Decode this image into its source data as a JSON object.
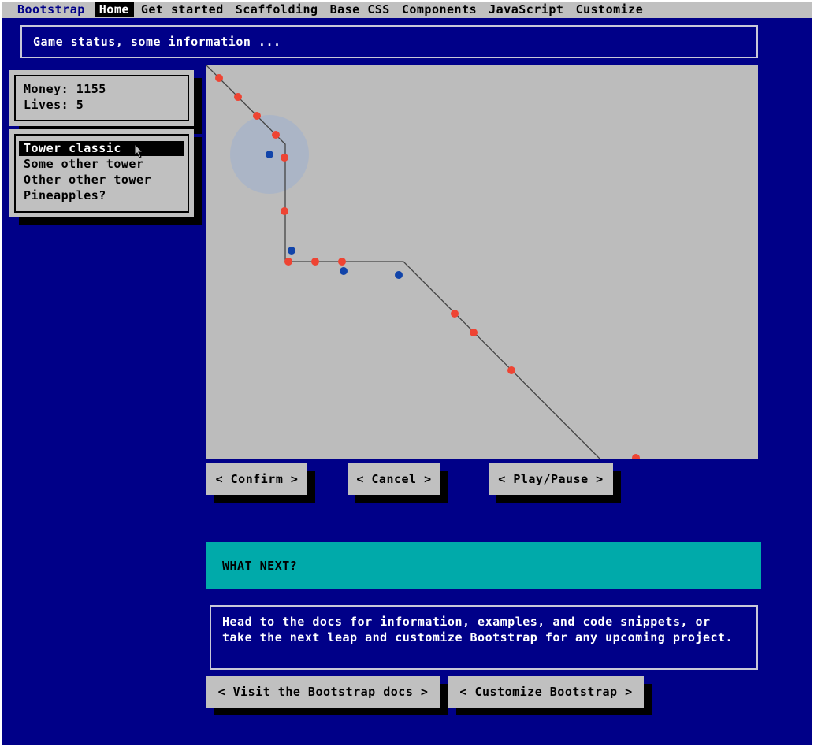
{
  "navbar": {
    "brand": "Bootstrap",
    "items": [
      "Home",
      "Get started",
      "Scaffolding",
      "Base CSS",
      "Components",
      "JavaScript",
      "Customize"
    ],
    "active": "Home"
  },
  "status_text": "Game status, some information ...",
  "stats": {
    "money": "Money: 1155",
    "lives": "Lives: 5"
  },
  "towers": {
    "items": [
      "Tower classic",
      "Some other tower",
      "Other other tower",
      "Pineapples?"
    ],
    "selected": "Tower classic"
  },
  "game": {
    "path_color": "#444444",
    "enemy_color": "#ee4433",
    "tower_color": "#1144aa",
    "range_color": "#a8b4c8"
  },
  "buttons": {
    "confirm": "< Confirm >",
    "cancel": "< Cancel >",
    "play_pause": "< Play/Pause >"
  },
  "what_next": "WHAT NEXT?",
  "info": "Head to the docs for information, examples, and code snippets, or take the next leap and customize Bootstrap for any upcoming project.",
  "links": {
    "docs": "< Visit the Bootstrap docs >",
    "customize": "< Customize Bootstrap >"
  },
  "colors": {
    "background": "#000088",
    "panel": "#c0c0c0",
    "accent": "#00aaaa"
  }
}
